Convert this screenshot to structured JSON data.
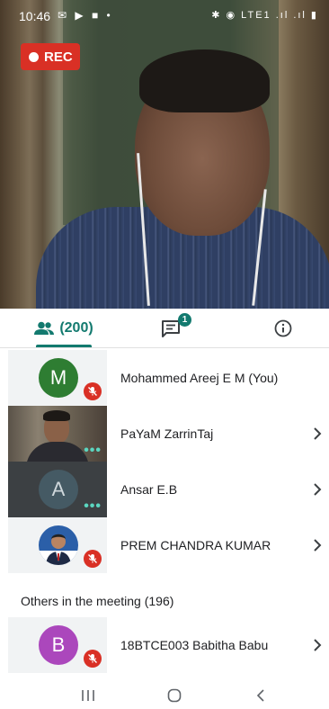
{
  "status_bar": {
    "time": "10:46",
    "left_icons": "✉ ▶ ■ •",
    "right_icons": "✱ ◉ LTE1 .ıl .ıl ▮"
  },
  "recording": {
    "label": "REC"
  },
  "tabs": {
    "people_count": "(200)",
    "chat_badge": "1"
  },
  "participants": [
    {
      "name": "Mohammed Areej E M (You)",
      "avatar_letter": "M",
      "avatar_color": "#2e7d32",
      "muted": true,
      "video": false
    },
    {
      "name": "PaYaM ZarrinTaj",
      "avatar_letter": "",
      "muted": false,
      "video": true
    },
    {
      "name": "Ansar E.B",
      "avatar_letter": "A",
      "avatar_color": "#455a64",
      "muted": false,
      "video": false
    },
    {
      "name": "PREM CHANDRA KUMAR",
      "avatar_letter": "",
      "muted": true,
      "video": false
    }
  ],
  "others": {
    "title": "Others in the meeting (196)",
    "items": [
      {
        "name": "18BTCE003 Babitha Babu",
        "avatar_letter": "B",
        "avatar_color": "#ab47bc",
        "muted": true
      }
    ]
  },
  "colors": {
    "accent": "#137a6f",
    "mute_red": "#d93025"
  }
}
